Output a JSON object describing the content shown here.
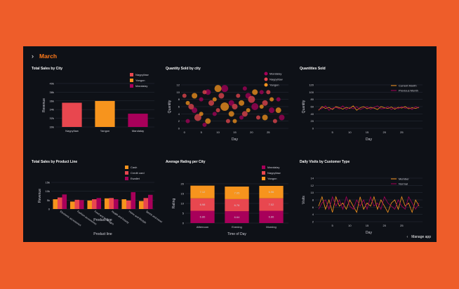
{
  "header": {
    "chevron": "chevron-right-icon",
    "title": "March"
  },
  "footer": {
    "chevron": "chevron-left-icon",
    "manage_label": "Manage app"
  },
  "colors": {
    "background": "#ee5d2a",
    "app_bg": "#0e1117",
    "accent": "#ff7a1a",
    "red": "#e8474f",
    "orange": "#f7941d",
    "magenta": "#a8005a",
    "pink": "#d6458d",
    "grid": "#2a2f3a"
  },
  "panels": {
    "total_sales_city": {
      "title": "Total Sales by City"
    },
    "qty_sold_city": {
      "title": "Quantity Sold by city"
    },
    "qty_sold": {
      "title": "Quantities Sold"
    },
    "sales_product_line": {
      "title": "Total Sales by Product Line"
    },
    "avg_rating_city": {
      "title": "Average Rating per City"
    },
    "daily_visits": {
      "title": "Daily Visits by Customer Type"
    }
  },
  "chart_data": [
    {
      "id": "total_sales_city",
      "type": "bar",
      "title": "Total Sales by City",
      "xlabel": "",
      "ylabel": "Revenue",
      "categories": [
        "NaypyItaw",
        "Yangon",
        "Mandalay"
      ],
      "values": [
        35568,
        35981,
        33052
      ],
      "colors": [
        "#e8474f",
        "#f7941d",
        "#a8005a"
      ],
      "legend": [
        "NaypyItaw",
        "Yangon",
        "Mandalay"
      ],
      "yticks": [
        "30k",
        "32k",
        "34k",
        "36k",
        "38k",
        "40k"
      ],
      "ylim": [
        30000,
        40000
      ],
      "grid": true,
      "legend_position": "top-right"
    },
    {
      "id": "qty_sold_city",
      "type": "scatter",
      "title": "Quantity Sold by city",
      "xlabel": "Day",
      "ylabel": "Quantity",
      "legend": [
        "Mandalay",
        "NaypyItaw",
        "Yangon"
      ],
      "colors": [
        "#a8005a",
        "#e8474f",
        "#f7941d"
      ],
      "xticks": [
        "0",
        "5",
        "10",
        "15",
        "20",
        "25"
      ],
      "yticks": [
        "0",
        "2",
        "4",
        "6",
        "8",
        "10",
        "12"
      ],
      "xlim": [
        -1,
        31
      ],
      "ylim": [
        0,
        12
      ],
      "series": [
        {
          "name": "Mandalay",
          "points": [
            [
              1,
              2,
              3
            ],
            [
              3,
              5,
              4
            ],
            [
              5,
              8,
              3
            ],
            [
              7,
              10,
              4
            ],
            [
              9,
              4,
              3
            ],
            [
              12,
              11,
              5
            ],
            [
              14,
              7,
              4
            ],
            [
              17,
              3,
              3
            ],
            [
              19,
              9,
              4
            ],
            [
              21,
              6,
              5
            ],
            [
              23,
              10,
              3
            ],
            [
              26,
              5,
              4
            ],
            [
              28,
              8,
              3
            ],
            [
              29,
              3,
              4
            ],
            [
              6,
              1,
              3
            ],
            [
              18,
              11,
              3
            ]
          ]
        },
        {
          "name": "NaypyItaw",
          "points": [
            [
              2,
              6,
              4
            ],
            [
              4,
              3,
              5
            ],
            [
              6,
              10,
              3
            ],
            [
              8,
              7,
              4
            ],
            [
              10,
              5,
              3
            ],
            [
              11,
              9,
              4
            ],
            [
              13,
              2,
              3
            ],
            [
              15,
              6,
              4
            ],
            [
              16,
              9,
              3
            ],
            [
              18,
              4,
              4
            ],
            [
              20,
              8,
              5
            ],
            [
              22,
              3,
              3
            ],
            [
              24,
              7,
              4
            ],
            [
              25,
              10,
              3
            ],
            [
              27,
              2,
              3
            ],
            [
              0,
              9,
              3
            ]
          ]
        },
        {
          "name": "Yangon",
          "points": [
            [
              1,
              7,
              3
            ],
            [
              3,
              9,
              4
            ],
            [
              5,
              4,
              3
            ],
            [
              7,
              2,
              4
            ],
            [
              9,
              8,
              3
            ],
            [
              10,
              11,
              5
            ],
            [
              12,
              6,
              6
            ],
            [
              14,
              4,
              4
            ],
            [
              15,
              2,
              3
            ],
            [
              17,
              7,
              4
            ],
            [
              19,
              5,
              3
            ],
            [
              21,
              10,
              4
            ],
            [
              23,
              6,
              3
            ],
            [
              24,
              3,
              4
            ],
            [
              26,
              8,
              3
            ],
            [
              28,
              5,
              4
            ]
          ]
        }
      ],
      "grid": true,
      "legend_position": "top-right"
    },
    {
      "id": "qty_sold",
      "type": "line",
      "title": "Quantities Sold",
      "xlabel": "Day",
      "ylabel": "Quantity",
      "xticks": [
        "5",
        "10",
        "15",
        "20",
        "25"
      ],
      "yticks": [
        "0",
        "20",
        "40",
        "60",
        "80",
        "100",
        "120"
      ],
      "xlim": [
        0,
        31
      ],
      "ylim": [
        0,
        120
      ],
      "x": [
        1,
        2,
        3,
        4,
        5,
        6,
        7,
        8,
        9,
        10,
        11,
        12,
        13,
        14,
        15,
        16,
        17,
        18,
        19,
        20,
        21,
        22,
        23,
        24,
        25,
        26,
        27,
        28,
        29,
        30
      ],
      "series": [
        {
          "name": "Current Month",
          "color": "#f7941d",
          "values": [
            50,
            60,
            55,
            58,
            52,
            60,
            57,
            53,
            58,
            55,
            62,
            50,
            57,
            60,
            54,
            58,
            56,
            52,
            60,
            57,
            55,
            59,
            53,
            58,
            56,
            60,
            54,
            57,
            55,
            58
          ]
        },
        {
          "name": "Previous Month",
          "color": "#a8005a",
          "values": [
            52,
            55,
            62,
            50,
            56,
            58,
            54,
            62,
            52,
            58,
            54,
            60,
            52,
            56,
            60,
            53,
            58,
            62,
            54,
            55,
            60,
            52,
            58,
            54,
            60,
            55,
            58,
            52,
            60,
            56
          ]
        }
      ],
      "grid": true,
      "legend_position": "top-right"
    },
    {
      "id": "sales_product_line",
      "type": "bar",
      "title": "Total Sales by Product Line",
      "xlabel": "Product line",
      "ylabel": "Revenue",
      "categories": [
        "Electronic accessories",
        "Fashion accessories",
        "Food and beverages",
        "Health and beauty",
        "Home and lifestyle",
        "Sports and travel"
      ],
      "series": [
        {
          "name": "Cash",
          "color": "#f7941d",
          "values": [
            5500,
            4200,
            4800,
            6000,
            5500,
            4500
          ]
        },
        {
          "name": "Credit card",
          "color": "#e8474f",
          "values": [
            6500,
            5200,
            5500,
            6200,
            4800,
            6200
          ]
        },
        {
          "name": "Ewallet",
          "color": "#a8005a",
          "values": [
            8200,
            5000,
            6200,
            5500,
            9500,
            8000
          ]
        }
      ],
      "yticks": [
        "0",
        "5k",
        "10k",
        "15k"
      ],
      "ylim": [
        0,
        15000
      ],
      "grid": true,
      "legend_position": "top-right"
    },
    {
      "id": "avg_rating_city",
      "type": "bar",
      "title": "Average Rating per City",
      "xlabel": "Time of Day",
      "ylabel": "Rating",
      "categories": [
        "Afternoon",
        "Evening",
        "Morning"
      ],
      "stacked": true,
      "series": [
        {
          "name": "Mandalay",
          "color": "#a8005a",
          "values": [
            6.86,
            6.64,
            6.86
          ]
        },
        {
          "name": "NaypyItaw",
          "color": "#e8474f",
          "values": [
            6.98,
            6.76,
            7.02
          ]
        },
        {
          "name": "Yangon",
          "color": "#f7941d",
          "values": [
            7.12,
            7.05,
            6.96
          ]
        }
      ],
      "yticks": [
        "0",
        "5",
        "10",
        "15",
        "20"
      ],
      "ylim": [
        0,
        22
      ],
      "grid": true,
      "legend_position": "top-right"
    },
    {
      "id": "daily_visits",
      "type": "line",
      "title": "Daily Visits by Customer Type",
      "xlabel": "Day",
      "ylabel": "Visits",
      "xticks": [
        "5",
        "10",
        "15",
        "20",
        "25"
      ],
      "yticks": [
        "2",
        "4",
        "6",
        "8",
        "10",
        "12",
        "14"
      ],
      "xlim": [
        0,
        31
      ],
      "ylim": [
        1,
        15
      ],
      "x": [
        1,
        2,
        3,
        4,
        5,
        6,
        7,
        8,
        9,
        10,
        11,
        12,
        13,
        14,
        15,
        16,
        17,
        18,
        19,
        20,
        21,
        22,
        23,
        24,
        25,
        26,
        27,
        28,
        29,
        30
      ],
      "series": [
        {
          "name": "Member",
          "color": "#f7941d",
          "values": [
            6,
            9,
            5,
            8,
            4,
            9,
            6,
            7,
            5,
            8,
            6,
            4,
            9,
            5,
            7,
            6,
            9,
            5,
            8,
            6,
            4,
            7,
            8,
            5,
            9,
            6,
            7,
            4,
            8,
            6
          ]
        },
        {
          "name": "Normal",
          "color": "#a8005a",
          "values": [
            5,
            7,
            8,
            5,
            9,
            6,
            8,
            5,
            9,
            6,
            5,
            8,
            6,
            8,
            5,
            9,
            6,
            7,
            5,
            9,
            7,
            6,
            5,
            8,
            6,
            5,
            9,
            7,
            5,
            7
          ]
        }
      ],
      "grid": true,
      "legend_position": "top-right"
    }
  ]
}
